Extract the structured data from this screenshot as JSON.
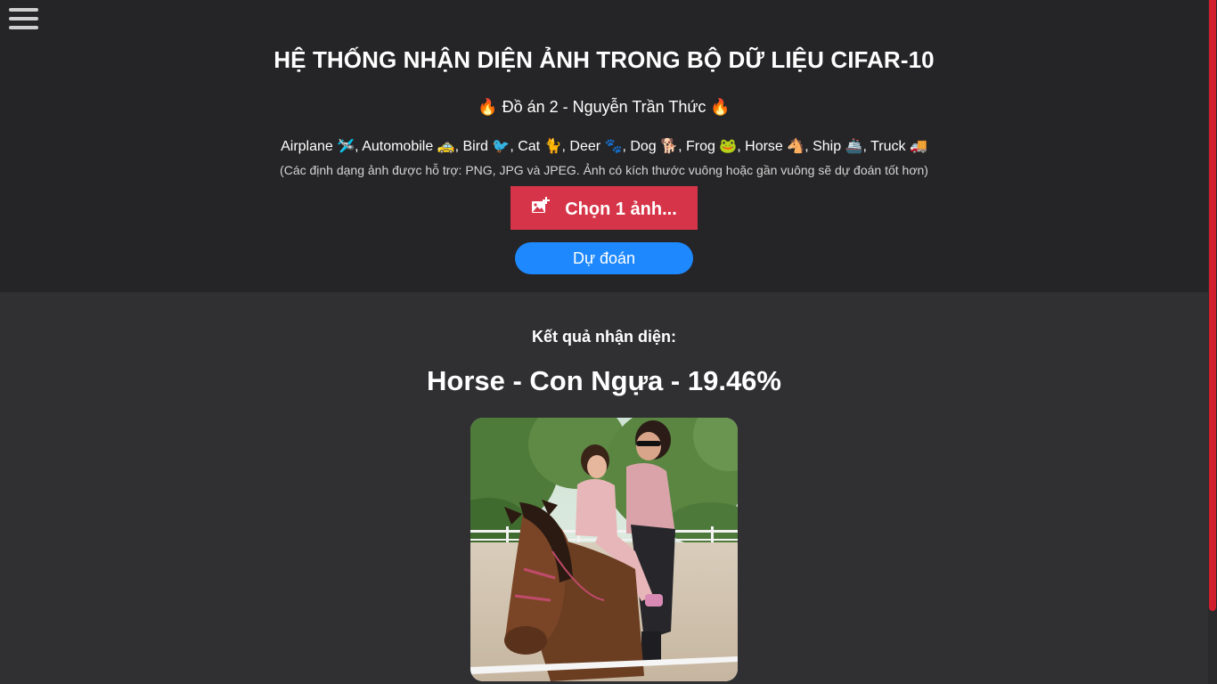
{
  "header": {
    "title": "HỆ THỐNG NHẬN DIỆN ẢNH TRONG BỘ DỮ LIỆU CIFAR-10",
    "subtitle": "🔥 Đồ án 2 - Nguyễn Trần Thức 🔥",
    "classes": [
      {
        "label": "Airplane",
        "emoji": "🛩️"
      },
      {
        "label": "Automobile",
        "emoji": "🚕"
      },
      {
        "label": "Bird",
        "emoji": "🐦"
      },
      {
        "label": "Cat",
        "emoji": "🐈"
      },
      {
        "label": "Deer",
        "emoji": "🐾"
      },
      {
        "label": "Dog",
        "emoji": "🐕"
      },
      {
        "label": "Frog",
        "emoji": "🐸"
      },
      {
        "label": "Horse",
        "emoji": "🐴"
      },
      {
        "label": "Ship",
        "emoji": "🚢"
      },
      {
        "label": "Truck",
        "emoji": "🚚"
      }
    ],
    "note": "(Các định dạng ảnh được hỗ trợ: PNG, JPG và JPEG. Ảnh có kích thước vuông hoặc gần vuông sẽ dự đoán tốt hơn)",
    "choose_label": "Chọn 1 ảnh...",
    "predict_label": "Dự đoán"
  },
  "results": {
    "label": "Kết quả nhận diện:",
    "prediction": "Horse - Con Ngựa - 19.46%"
  },
  "colors": {
    "choose_button": "#d63549",
    "predict_button": "#1e88ff",
    "header_bg": "#252527",
    "results_bg": "#303033",
    "scrollbar_thumb": "#d31f2d"
  },
  "icons": {
    "menu": "hamburger-icon",
    "choose": "add-image-icon"
  }
}
